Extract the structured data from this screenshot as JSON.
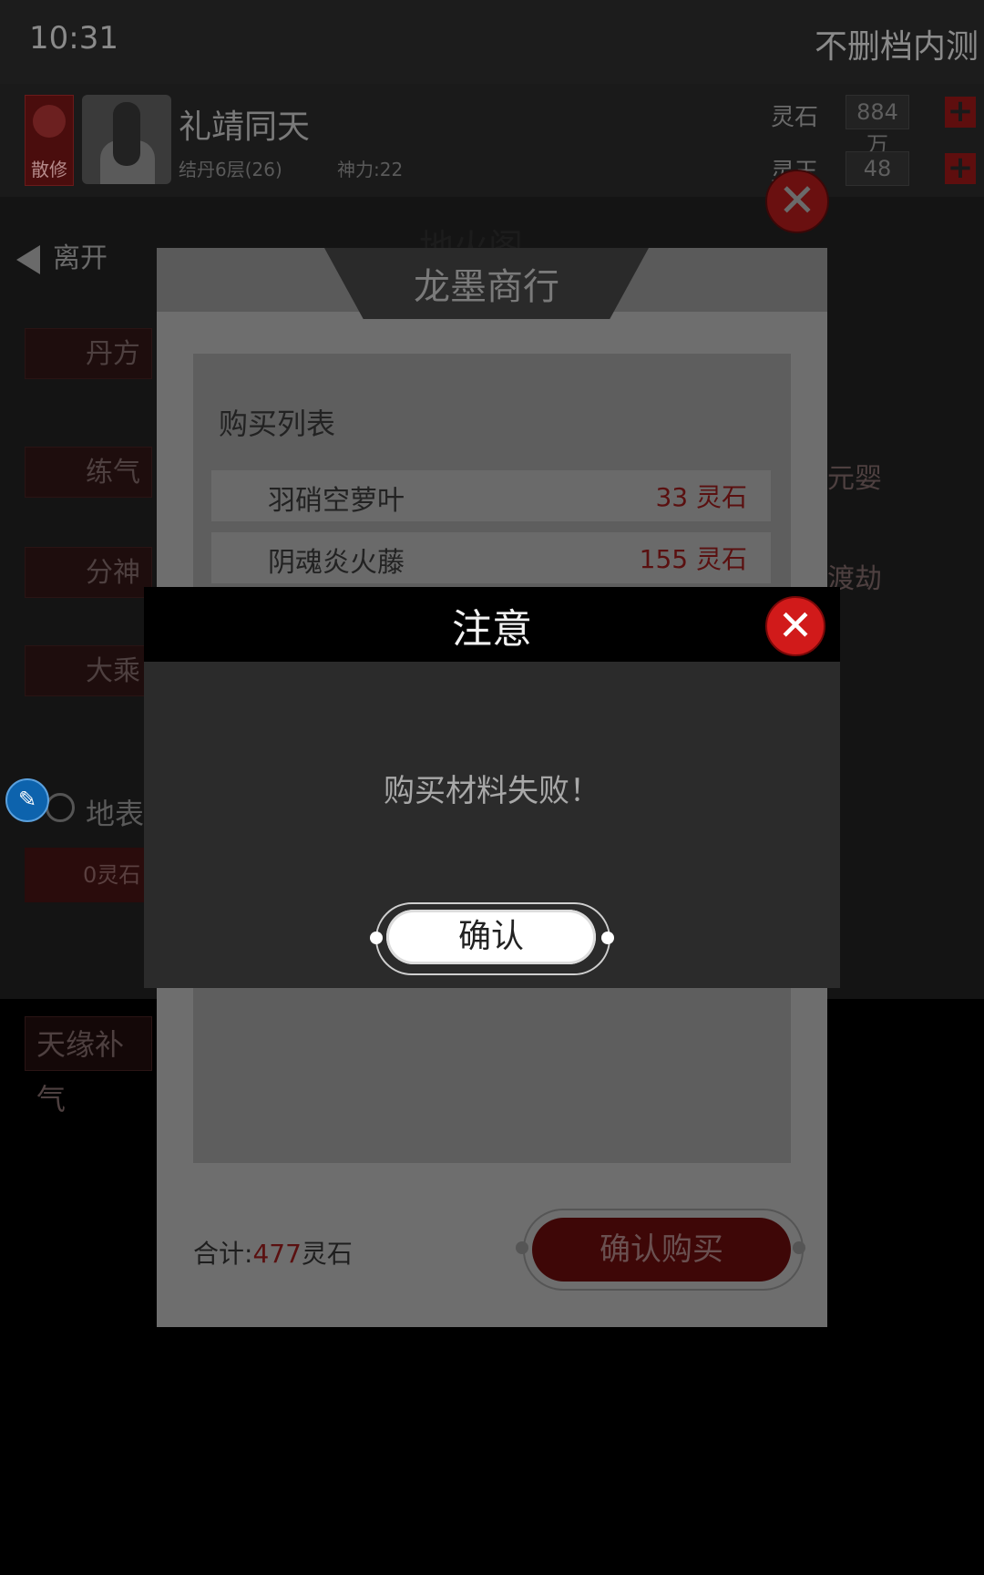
{
  "status": {
    "time": "10:31",
    "server": "不删档内测"
  },
  "player": {
    "sect_badge": "散修",
    "name": "礼靖同天",
    "level": "结丹6层(26)",
    "power": "神力:22"
  },
  "currencies": [
    {
      "label": "灵石",
      "value": "884万"
    },
    {
      "label": "灵玉",
      "value": "48"
    }
  ],
  "background": {
    "back_label": "离开",
    "page_title": "地火阁",
    "categories_left": [
      "丹方",
      "练气",
      "分神",
      "大乘"
    ],
    "categories_right": [
      "元婴",
      "渡劫"
    ],
    "option_label": "地表",
    "option_price": "0灵石",
    "bottom_button": "天缘补气"
  },
  "shop": {
    "title": "龙墨商行",
    "subtitle": "购买列表",
    "items": [
      {
        "name": "羽硝空萝叶",
        "price": "33 灵石"
      },
      {
        "name": "阴魂炎火藤",
        "price": "155 灵石"
      }
    ],
    "total_label": "合计:",
    "total_value": "477",
    "total_unit": "灵石",
    "confirm_label": "确认购买"
  },
  "alert": {
    "title": "注意",
    "message": "购买材料失败！",
    "ok_label": "确认"
  }
}
